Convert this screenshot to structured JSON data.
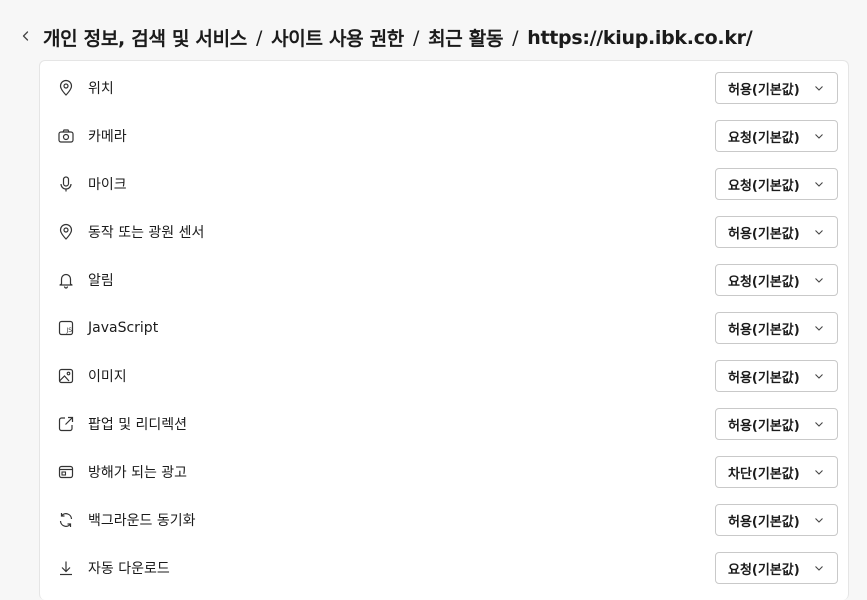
{
  "breadcrumb": {
    "items": [
      "개인 정보, 검색 및 서비스",
      "사이트 사용 권한",
      "최근 활동",
      "https://kiup.ibk.co.kr/"
    ],
    "separator": "/"
  },
  "permissions": [
    {
      "label": "위치",
      "icon": "location-icon",
      "value": "허용(기본값)"
    },
    {
      "label": "카메라",
      "icon": "camera-icon",
      "value": "요청(기본값)"
    },
    {
      "label": "마이크",
      "icon": "microphone-icon",
      "value": "요청(기본값)"
    },
    {
      "label": "동작 또는 광원 센서",
      "icon": "sensor-icon",
      "value": "허용(기본값)"
    },
    {
      "label": "알림",
      "icon": "bell-icon",
      "value": "요청(기본값)"
    },
    {
      "label": "JavaScript",
      "icon": "javascript-icon",
      "value": "허용(기본값)"
    },
    {
      "label": "이미지",
      "icon": "image-icon",
      "value": "허용(기본값)"
    },
    {
      "label": "팝업 및 리디렉션",
      "icon": "popup-icon",
      "value": "허용(기본값)"
    },
    {
      "label": "방해가 되는 광고",
      "icon": "ads-icon",
      "value": "차단(기본값)"
    },
    {
      "label": "백그라운드 동기화",
      "icon": "sync-icon",
      "value": "허용(기본값)"
    },
    {
      "label": "자동 다운로드",
      "icon": "download-icon",
      "value": "요청(기본값)"
    }
  ]
}
